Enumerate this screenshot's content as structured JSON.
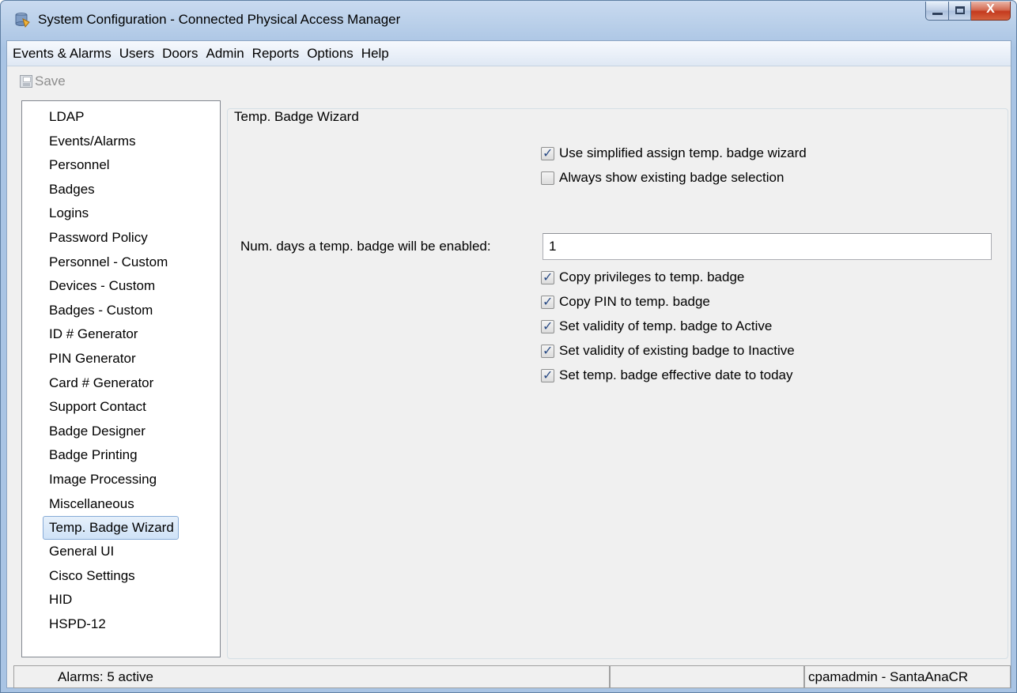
{
  "window": {
    "title": "System Configuration - Connected Physical Access Manager",
    "icon": "database-app-icon",
    "minimize_icon": "minimize-icon",
    "maximize_icon": "maximize-icon",
    "close_glyph": "X"
  },
  "menubar": {
    "items": [
      "Events & Alarms",
      "Users",
      "Doors",
      "Admin",
      "Reports",
      "Options",
      "Help"
    ]
  },
  "toolbar": {
    "save_label": "Save",
    "save_icon": "floppy-disk-icon",
    "save_enabled": false
  },
  "sidebar": {
    "items": [
      "LDAP",
      "Events/Alarms",
      "Personnel",
      "Badges",
      "Logins",
      "Password Policy",
      "Personnel - Custom",
      "Devices - Custom",
      "Badges - Custom",
      "ID # Generator",
      "PIN Generator",
      "Card # Generator",
      "Support Contact",
      "Badge Designer",
      "Badge Printing",
      "Image Processing",
      "Miscellaneous",
      "Temp. Badge Wizard",
      "General UI",
      "Cisco Settings",
      "HID",
      "HSPD-12"
    ],
    "selected": "Temp. Badge Wizard"
  },
  "panel": {
    "title": "Temp. Badge Wizard",
    "options_top": [
      {
        "label": "Use simplified assign temp. badge wizard",
        "checked": true
      },
      {
        "label": "Always show existing badge selection",
        "checked": false
      }
    ],
    "days_label": "Num. days a temp. badge will be enabled:",
    "days_value": "1",
    "options_bottom": [
      {
        "label": "Copy privileges to temp. badge",
        "checked": true
      },
      {
        "label": "Copy PIN to temp. badge",
        "checked": true
      },
      {
        "label": "Set validity of temp. badge to Active",
        "checked": true
      },
      {
        "label": "Set validity of existing badge to Inactive",
        "checked": true
      },
      {
        "label": "Set temp. badge effective date to today",
        "checked": true
      }
    ]
  },
  "statusbar": {
    "alarms": "Alarms: 5 active",
    "middle": "",
    "user": "cpamadmin - SantaAnaCR"
  },
  "colors": {
    "frame": "#b9cfe9",
    "client": "#f0f0f0",
    "selection_border": "#86aad6",
    "checkmark": "#2b4c85",
    "close_button": "#c43a1e"
  }
}
